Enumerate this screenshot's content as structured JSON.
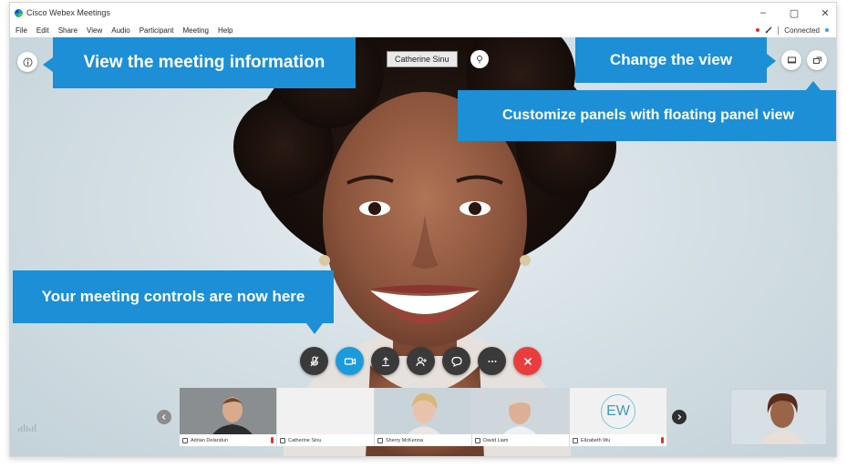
{
  "window": {
    "title": "Cisco Webex Meetings",
    "controls": {
      "minimize": "–",
      "maximize": "▢",
      "close": "✕"
    }
  },
  "menu": [
    "File",
    "Edit",
    "Share",
    "View",
    "Audio",
    "Participant",
    "Meeting",
    "Help"
  ],
  "status": {
    "connection": "Connected"
  },
  "active_speaker": {
    "name": "Catherine Sinu"
  },
  "callouts": {
    "meeting_info": "View the meeting information",
    "change_view": "Change the view",
    "floating_panels": "Customize panels with floating panel view",
    "controls": "Your meeting controls are now here"
  },
  "controls": [
    {
      "name": "mute",
      "icon": "mic-muted-icon"
    },
    {
      "name": "video",
      "icon": "video-icon"
    },
    {
      "name": "share",
      "icon": "share-icon"
    },
    {
      "name": "participants",
      "icon": "participants-icon"
    },
    {
      "name": "chat",
      "icon": "chat-icon"
    },
    {
      "name": "more",
      "icon": "more-icon"
    },
    {
      "name": "leave",
      "icon": "close-icon"
    }
  ],
  "participants": [
    {
      "name": "Adrian Delandun",
      "initials": ""
    },
    {
      "name": "Catherine Sinu",
      "initials": ""
    },
    {
      "name": "Sherry McKenna",
      "initials": ""
    },
    {
      "name": "David Liam",
      "initials": ""
    },
    {
      "name": "Elizabeth Wu",
      "initials": "EW"
    }
  ],
  "colors": {
    "accent": "#1c8fd6",
    "end_call": "#ea3e3e",
    "video_active": "#1c9bdc"
  }
}
